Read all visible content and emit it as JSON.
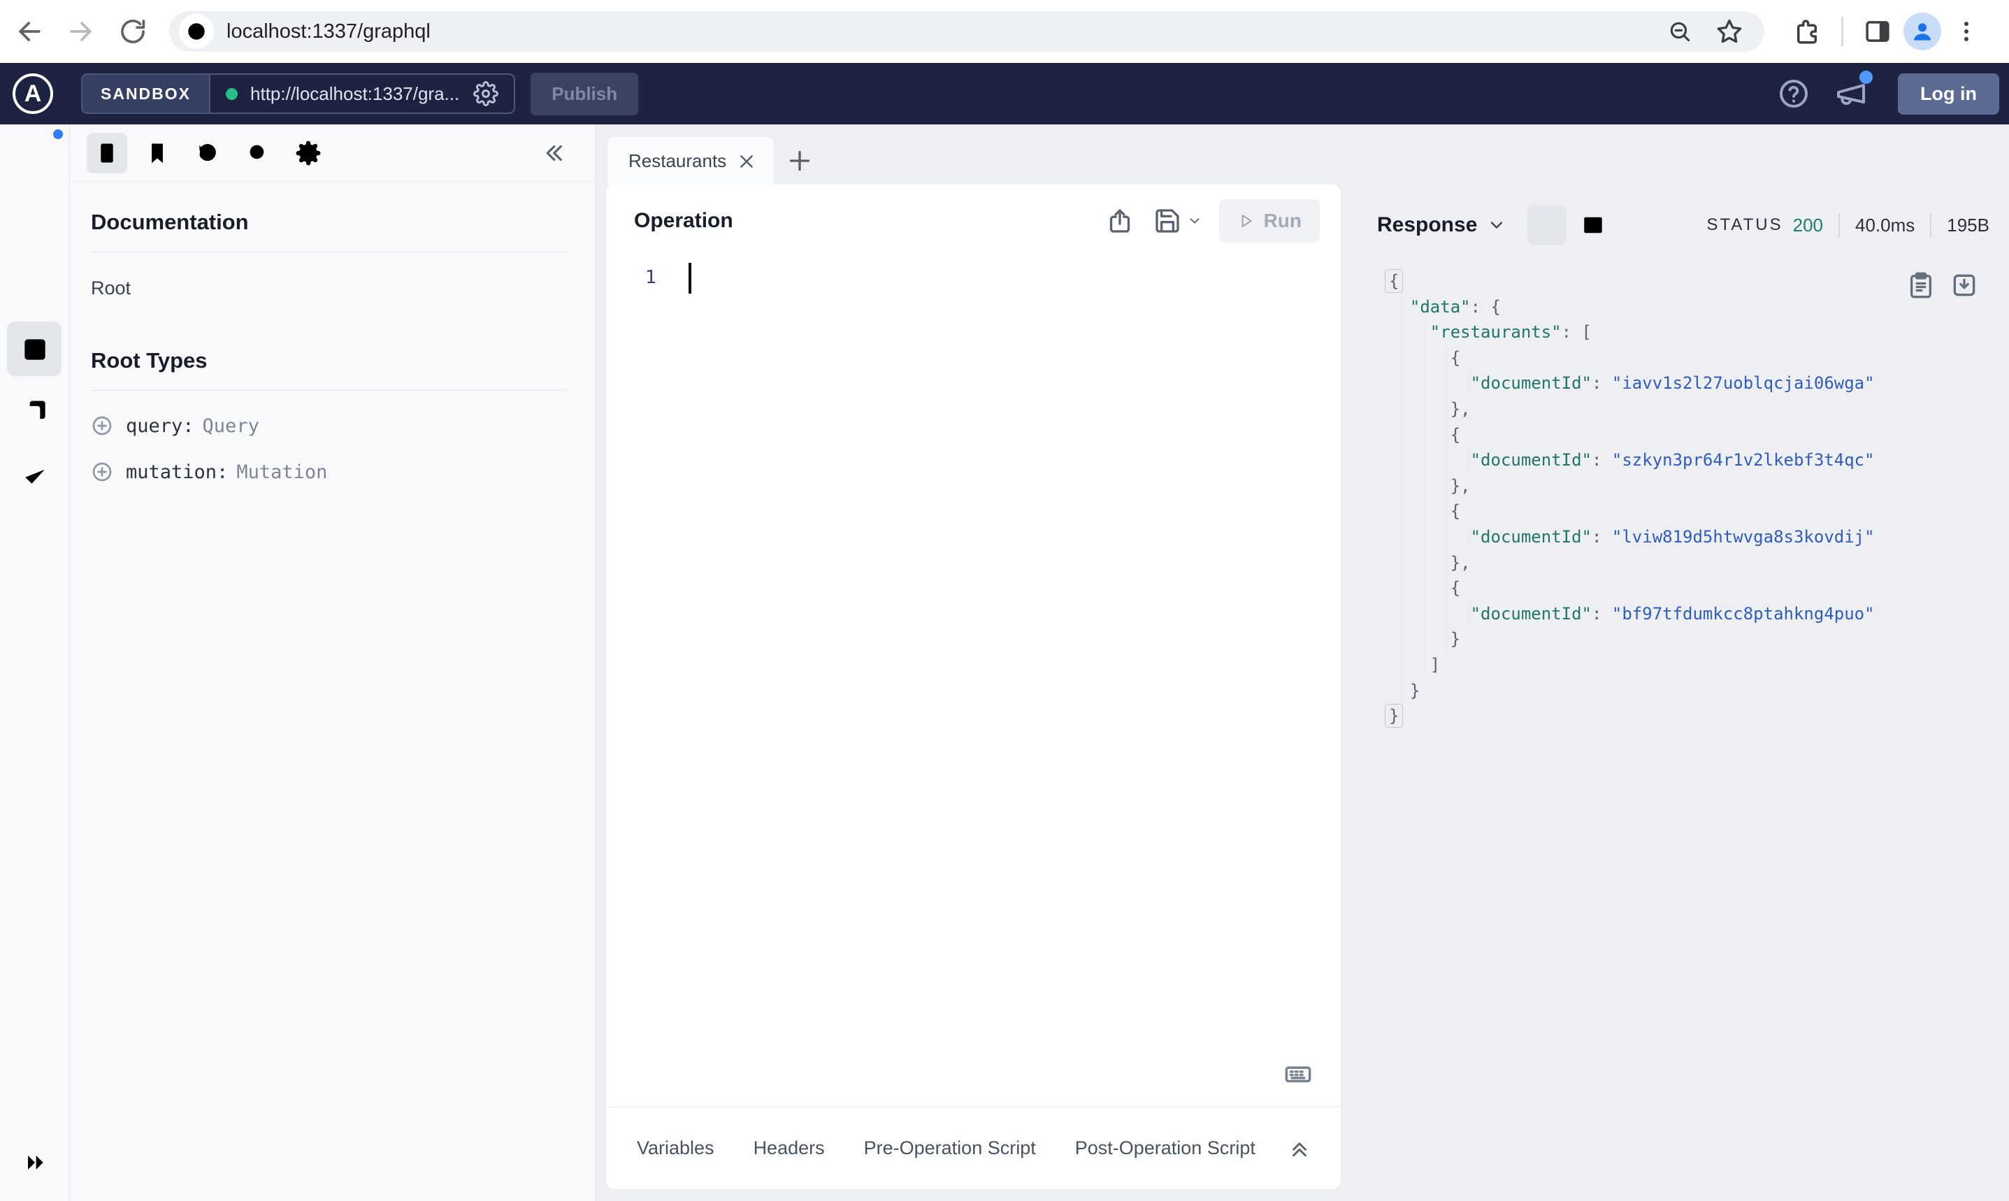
{
  "browser": {
    "url": "localhost:1337/graphql"
  },
  "app_header": {
    "logo_letter": "A",
    "sandbox_label": "SANDBOX",
    "endpoint_url": "http://localhost:1337/gra...",
    "publish_label": "Publish",
    "login_label": "Log in"
  },
  "docs": {
    "title": "Documentation",
    "root_link": "Root",
    "root_types_title": "Root Types",
    "fields": [
      {
        "name": "query:",
        "type": "Query"
      },
      {
        "name": "mutation:",
        "type": "Mutation"
      }
    ]
  },
  "tabs": {
    "active_label": "Restaurants"
  },
  "operation": {
    "title": "Operation",
    "run_label": "Run",
    "line_number": "1"
  },
  "footer_tabs": [
    "Variables",
    "Headers",
    "Pre-Operation Script",
    "Post-Operation Script"
  ],
  "response": {
    "title": "Response",
    "status_label": "STATUS",
    "status_code": "200",
    "duration": "40.0ms",
    "size": "195B",
    "body": {
      "data": {
        "restaurants": [
          {
            "documentId": "iavv1s2l27uoblqcjai06wga"
          },
          {
            "documentId": "szkyn3pr64r1v2lkebf3t4qc"
          },
          {
            "documentId": "lviw819d5htwvga8s3kovdij"
          },
          {
            "documentId": "bf97tfdumkcc8ptahkng4puo"
          }
        ]
      }
    }
  },
  "colors": {
    "header_bg": "#1d2340",
    "status_ok": "#1f7e6b",
    "json_key": "#22756c",
    "json_string": "#2f5cc2",
    "notification_blue": "#4c9aff"
  }
}
